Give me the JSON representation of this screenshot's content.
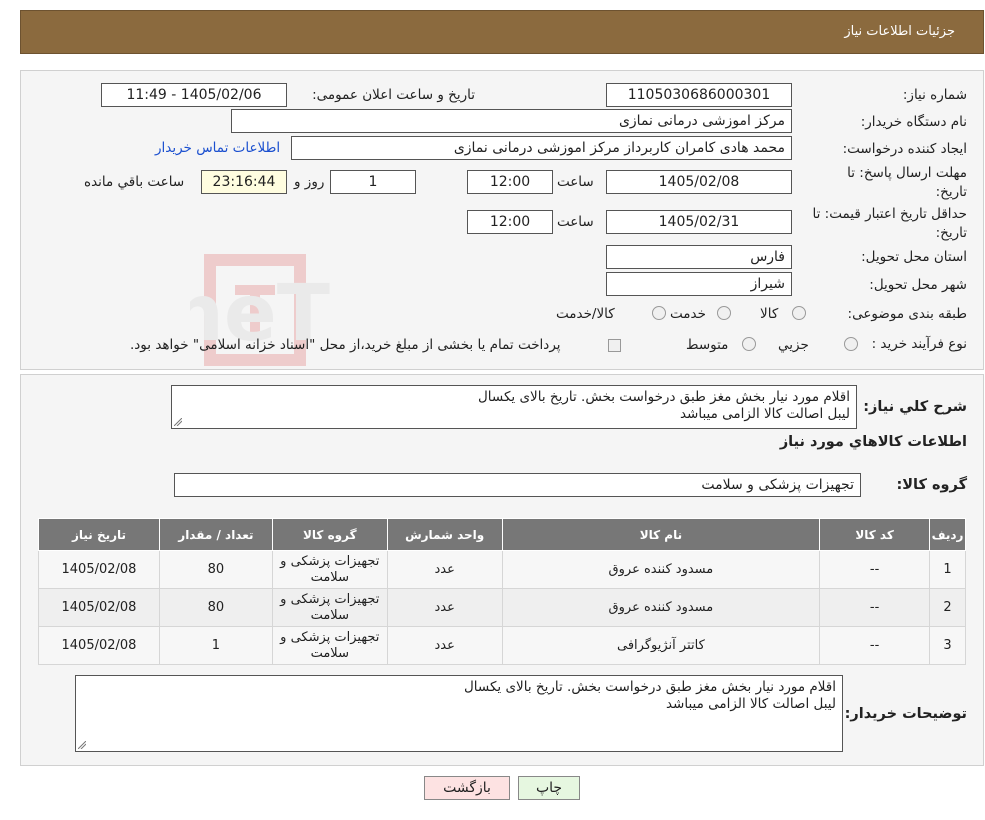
{
  "header": {
    "title": "جزئیات اطلاعات نیاز"
  },
  "info": {
    "need_number_label": "شماره نیاز:",
    "need_number": "1105030686000301",
    "announce_label": "تاریخ و ساعت اعلان عمومی:",
    "announce_value": "1405/02/06 - 11:49",
    "buyer_org_label": "نام دستگاه خریدار:",
    "buyer_org": "مرکز اموزشی درمانی نمازی",
    "creator_label": "ایجاد کننده درخواست:",
    "creator": "محمد هادی کامران کاربرداز مرکز اموزشی درمانی نمازی",
    "contact_link": "اطلاعات تماس خریدار",
    "deadline_label_1": "مهلت ارسال پاسخ: تا",
    "deadline_label_2": "تاریخ:",
    "deadline_date": "1405/02/08",
    "time_label": "ساعت",
    "deadline_time": "12:00",
    "days_value": "1",
    "days_label": "روز و",
    "remaining_time": "23:16:44",
    "remaining_label": "ساعت باقي مانده",
    "validity_label_1": "حداقل تاریخ اعتبار قیمت: تا",
    "validity_label_2": "تاریخ:",
    "validity_date": "1405/02/31",
    "validity_time": "12:00",
    "province_label": "استان محل تحویل:",
    "province": "فارس",
    "city_label": "شهر محل تحویل:",
    "city": "شیراز",
    "category_label": "طبقه بندی موضوعی:",
    "category_options": [
      "کالا",
      "خدمت",
      "کالا/خدمت"
    ],
    "process_label": "نوع فرآیند خرید :",
    "process_options": [
      "جزیي",
      "متوسط"
    ],
    "process_note": "پرداخت تمام یا بخشی از مبلغ خرید،از محل \"اسناد خزانه اسلامی\" خواهد بود."
  },
  "summary": {
    "label": "شرح کلي نیاز:",
    "line1": "اقلام مورد نیار بخش مغز طبق درخواست بخش. تاریخ بالای یکسال",
    "line2": "لیبل اصالت کالا الزامی میباشد"
  },
  "goods": {
    "section_title": "اطلاعات کالاهاي مورد نیاز",
    "group_label": "گروه کالا:",
    "group_value": "تجهیزات پزشکی و سلامت",
    "columns": [
      "ردیف",
      "کد کالا",
      "نام کالا",
      "واحد شمارش",
      "گروه کالا",
      "تعداد / مقدار",
      "تاریخ نیاز"
    ],
    "rows": [
      {
        "row": "1",
        "code": "--",
        "name": "مسدود کننده عروق",
        "unit": "عدد",
        "group_l1": "تجهیزات پزشکی و",
        "group_l2": "سلامت",
        "qty": "80",
        "date": "1405/02/08"
      },
      {
        "row": "2",
        "code": "--",
        "name": "مسدود کننده عروق",
        "unit": "عدد",
        "group_l1": "تجهیزات پزشکی و",
        "group_l2": "سلامت",
        "qty": "80",
        "date": "1405/02/08"
      },
      {
        "row": "3",
        "code": "--",
        "name": "کاتتر آنژیوگرافی",
        "unit": "عدد",
        "group_l1": "تجهیزات پزشکی و",
        "group_l2": "سلامت",
        "qty": "1",
        "date": "1405/02/08"
      }
    ]
  },
  "buyer_notes": {
    "label": "توضیحات خریدار:",
    "line1": "اقلام مورد نیار بخش مغز طبق درخواست بخش. تاریخ بالای یکسال",
    "line2": "لیبل اصالت کالا الزامی میباشد"
  },
  "buttons": {
    "back": "بازگشت",
    "print": "چاپ"
  },
  "watermark": {
    "text": "AriaTender.neT"
  },
  "colors": {
    "header_bg": "#8b6a3e",
    "link": "#1a4fcf",
    "table_header": "#777777",
    "remaining_bg": "#fffde0"
  }
}
